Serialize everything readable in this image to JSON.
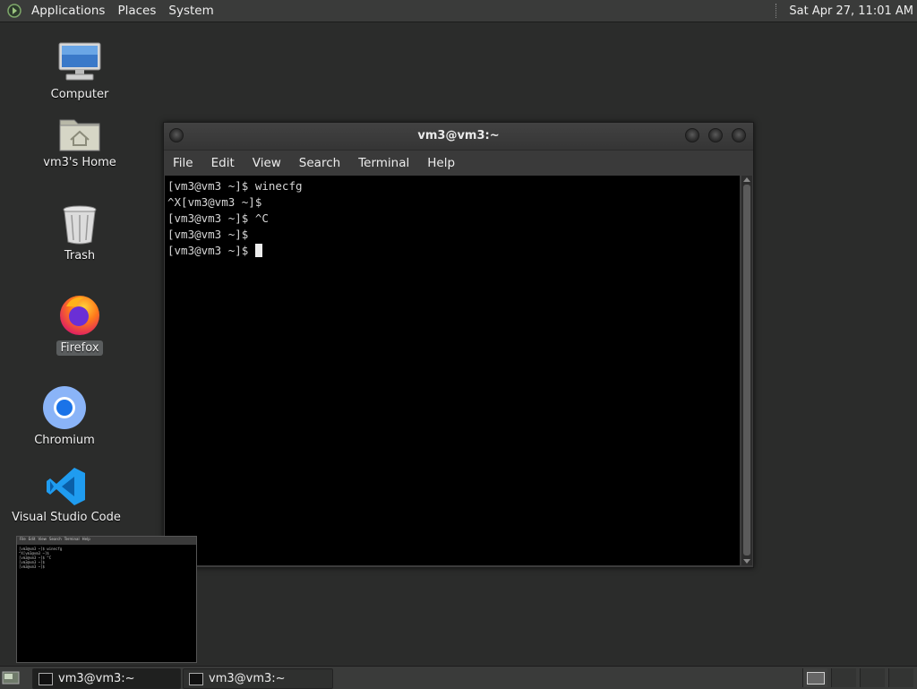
{
  "top_panel": {
    "menus": [
      "Applications",
      "Places",
      "System"
    ],
    "clock": "Sat Apr 27, 11:01 AM"
  },
  "desktop": {
    "icons": [
      {
        "label": "Computer",
        "icon": "computer-icon"
      },
      {
        "label": "vm3's Home",
        "icon": "home-folder-icon"
      },
      {
        "label": "Trash",
        "icon": "trash-icon"
      },
      {
        "label": "Firefox",
        "icon": "firefox-icon",
        "selected": true
      },
      {
        "label": "Chromium",
        "icon": "chromium-icon"
      },
      {
        "label": "Visual Studio Code",
        "icon": "vscode-icon"
      }
    ]
  },
  "terminal": {
    "title": "vm3@vm3:~",
    "menu": [
      "File",
      "Edit",
      "View",
      "Search",
      "Terminal",
      "Help"
    ],
    "lines": [
      "[vm3@vm3 ~]$ winecfg",
      "^X[vm3@vm3 ~]$",
      "[vm3@vm3 ~]$ ^C",
      "[vm3@vm3 ~]$",
      "[vm3@vm3 ~]$ "
    ]
  },
  "taskbar": {
    "tasks": [
      {
        "label": "vm3@vm3:~",
        "active": true
      },
      {
        "label": "vm3@vm3:~",
        "active": false
      }
    ]
  },
  "colors": {
    "desktop_bg": "#2b2c2b",
    "panel_bg": "#3a3b3a",
    "terminal_bg": "#000000",
    "terminal_fg": "#d6d6d6"
  }
}
